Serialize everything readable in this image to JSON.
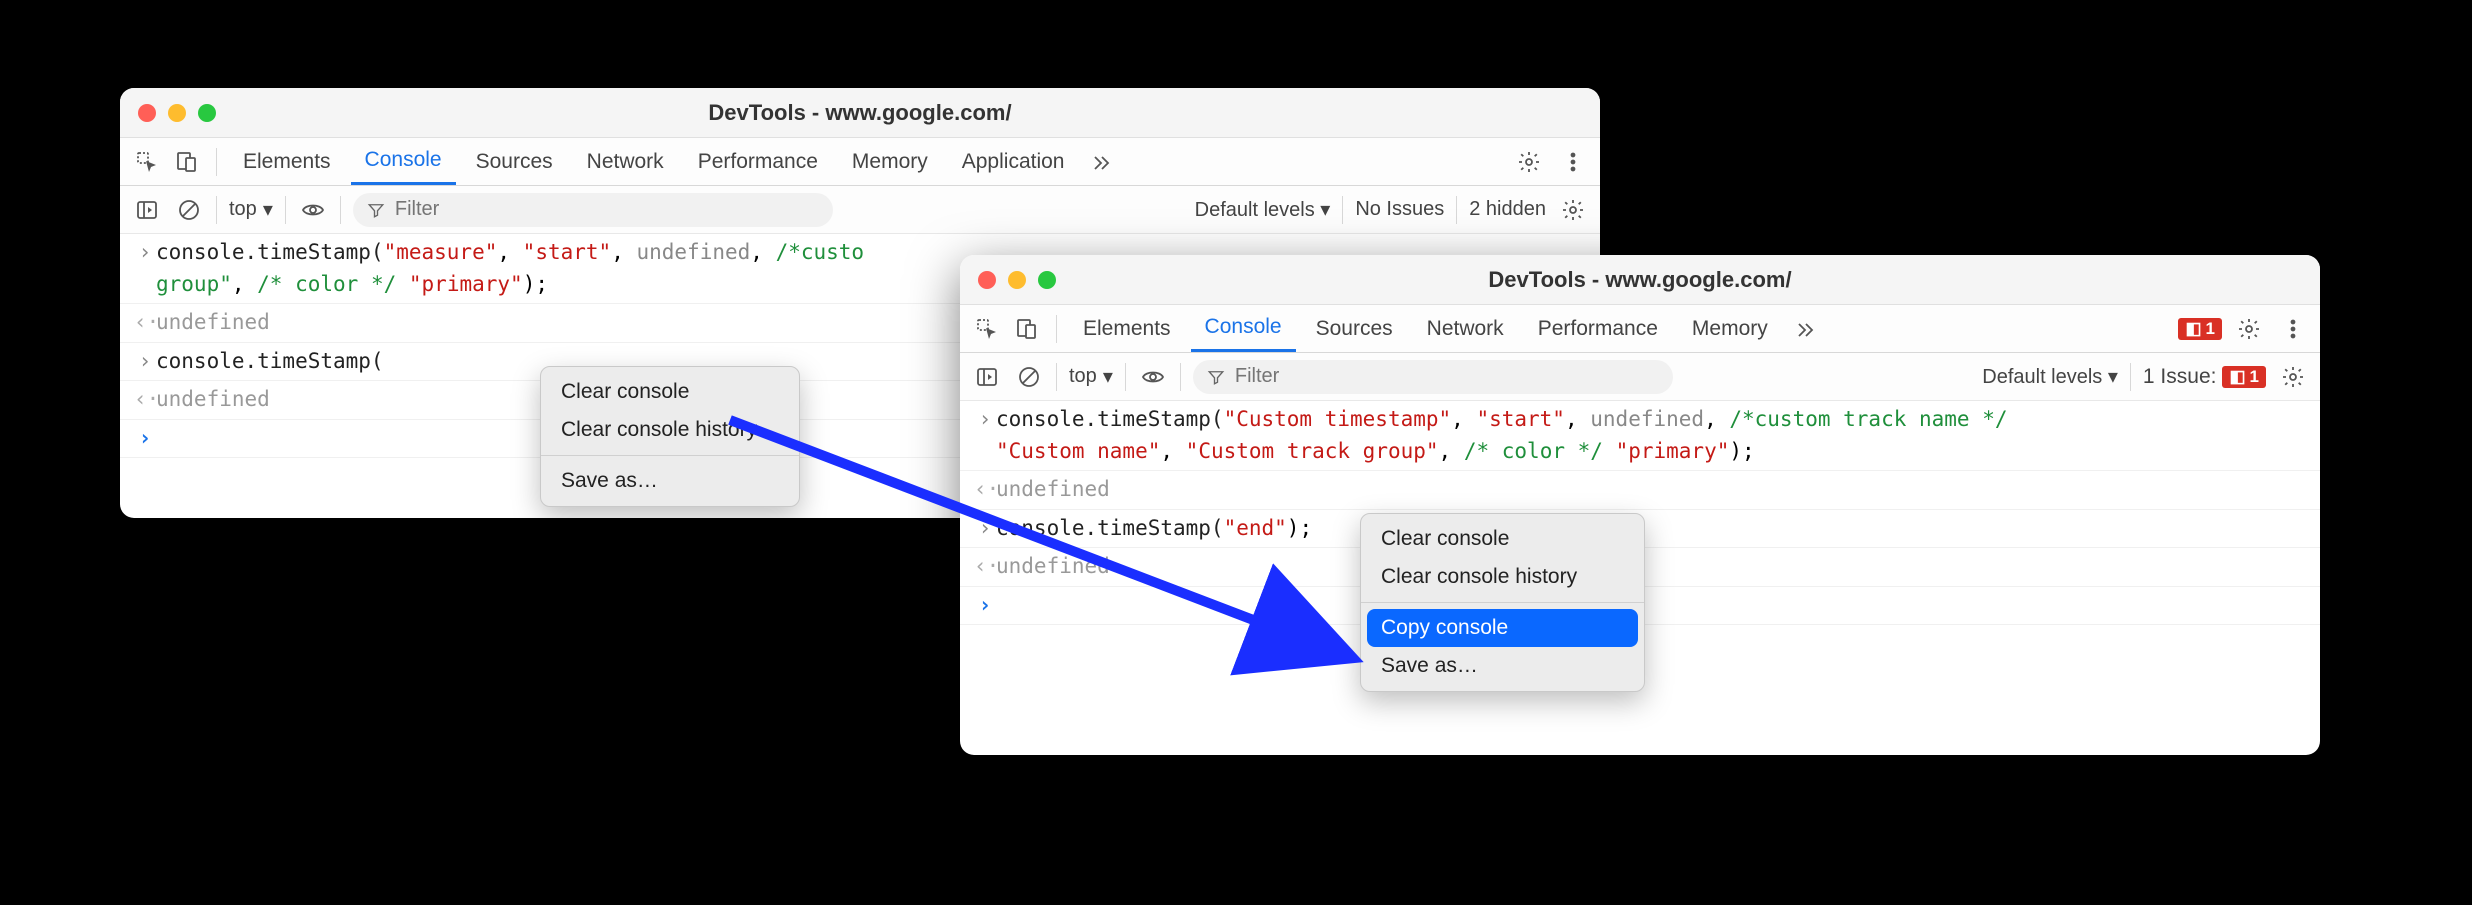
{
  "windowA": {
    "title": "DevTools - www.google.com/",
    "tabs": [
      "Elements",
      "Console",
      "Sources",
      "Network",
      "Performance",
      "Memory",
      "Application"
    ],
    "activeTab": "Console",
    "top": "top",
    "filterPlaceholder": "Filter",
    "levels": "Default levels",
    "issues": "No Issues",
    "hidden": "2 hidden",
    "console": {
      "line1": {
        "fn": "console.timeStamp(",
        "args": "\"measure\", \"start\", undefined, /*custo",
        "cont": "group\", /* color */ \"primary\");"
      },
      "res1": "undefined",
      "line2_fn": "console.timeStamp(",
      "res2": "undefined"
    },
    "menu": {
      "clear": "Clear console",
      "history": "Clear console history",
      "save": "Save as…"
    }
  },
  "windowB": {
    "title": "DevTools - www.google.com/",
    "tabs": [
      "Elements",
      "Console",
      "Sources",
      "Network",
      "Performance",
      "Memory"
    ],
    "activeTab": "Console",
    "errBadge": "1",
    "top": "top",
    "filterPlaceholder": "Filter",
    "levels": "Default levels",
    "issuesLabel": "1 Issue:",
    "issuesBadge": "1",
    "console": {
      "line1_pre": "console.timeStamp(",
      "line1_args": "\"Custom timestamp\", \"start\", undefined, /*custom track name */",
      "line1_cont": "\"Custom name\", \"Custom track group\", /* color */ \"primary\");",
      "res1": "undefined",
      "line2_pre": "console.timeStamp(",
      "line2_arg": "\"end\"",
      "line2_post": ");",
      "res2": "undefined"
    },
    "menu": {
      "clear": "Clear console",
      "history": "Clear console history",
      "copy": "Copy console",
      "save": "Save as…"
    }
  }
}
